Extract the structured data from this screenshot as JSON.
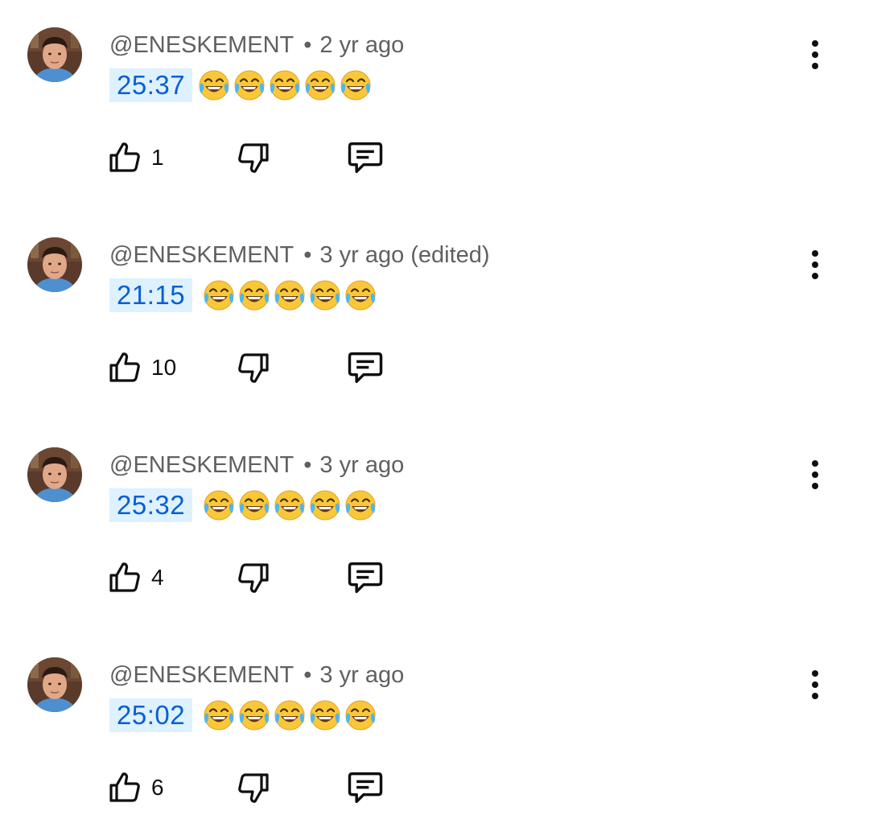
{
  "comments": [
    {
      "handle": "@ENESKEMENT",
      "separator": "•",
      "age": "2 yr ago",
      "timestamp": "25:37",
      "emoji_name": "face-with-tears-of-joy",
      "emoji_count": 5,
      "likes": "1"
    },
    {
      "handle": "@ENESKEMENT",
      "separator": "•",
      "age": "3 yr ago (edited)",
      "timestamp": "21:15",
      "emoji_name": "face-with-tears-of-joy",
      "emoji_count": 5,
      "likes": "10"
    },
    {
      "handle": "@ENESKEMENT",
      "separator": "•",
      "age": "3 yr ago",
      "timestamp": "25:32",
      "emoji_name": "face-with-tears-of-joy",
      "emoji_count": 5,
      "likes": "4"
    },
    {
      "handle": "@ENESKEMENT",
      "separator": "•",
      "age": "3 yr ago",
      "timestamp": "25:02",
      "emoji_name": "face-with-tears-of-joy",
      "emoji_count": 5,
      "likes": "6"
    }
  ],
  "icons": {
    "like": "thumbs-up-icon",
    "dislike": "thumbs-down-icon",
    "reply": "comment-reply-icon",
    "menu": "more-vertical-icon"
  },
  "colors": {
    "timestamp_text": "#065fd4",
    "timestamp_background": "#def1ff",
    "meta_text": "#606060",
    "icon": "#0f0f0f"
  }
}
